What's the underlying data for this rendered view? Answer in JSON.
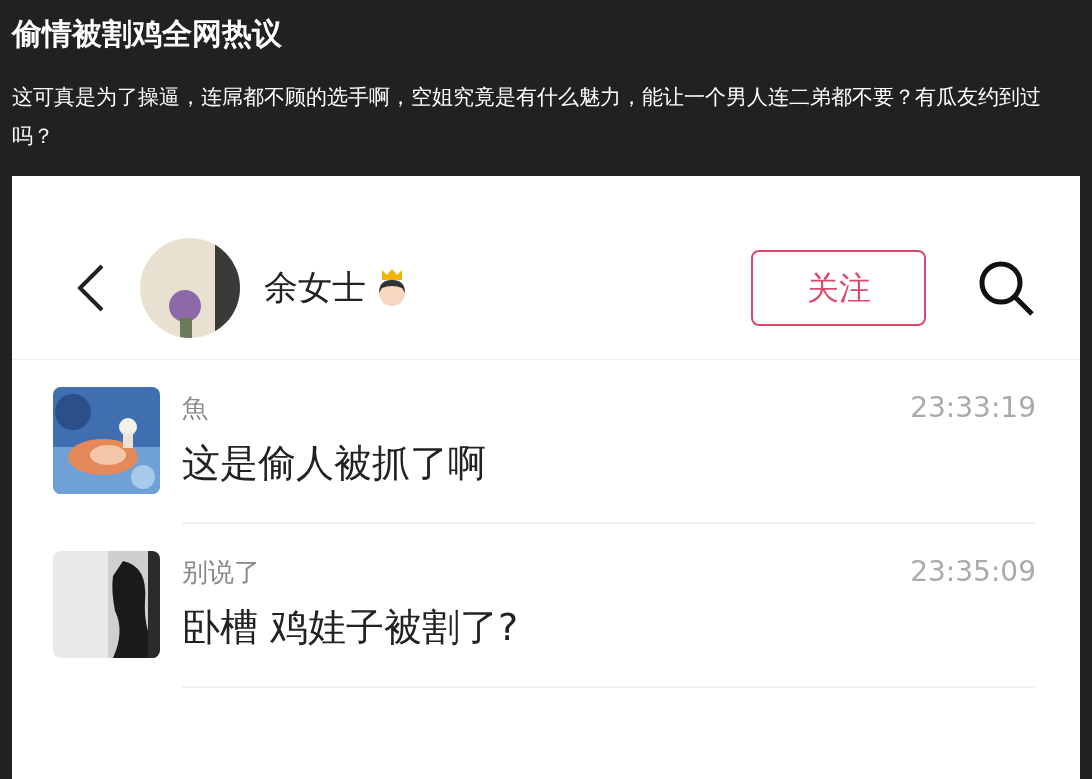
{
  "article": {
    "title": "偷情被割鸡全网热议",
    "body": "这可真是为了操逼，连屌都不顾的选手啊，空姐究竟是有什么魅力，能让一个男人连二弟都不要？有瓜友约到过吗？"
  },
  "screenshot": {
    "header": {
      "name": "余女士",
      "follow_label": "关注"
    },
    "messages": [
      {
        "name": "魚",
        "time": "23:33:19",
        "text": "这是偷人被抓了啊"
      },
      {
        "name": "别说了",
        "time": "23:35:09",
        "text": "卧槽 鸡娃子被割了?"
      }
    ]
  }
}
